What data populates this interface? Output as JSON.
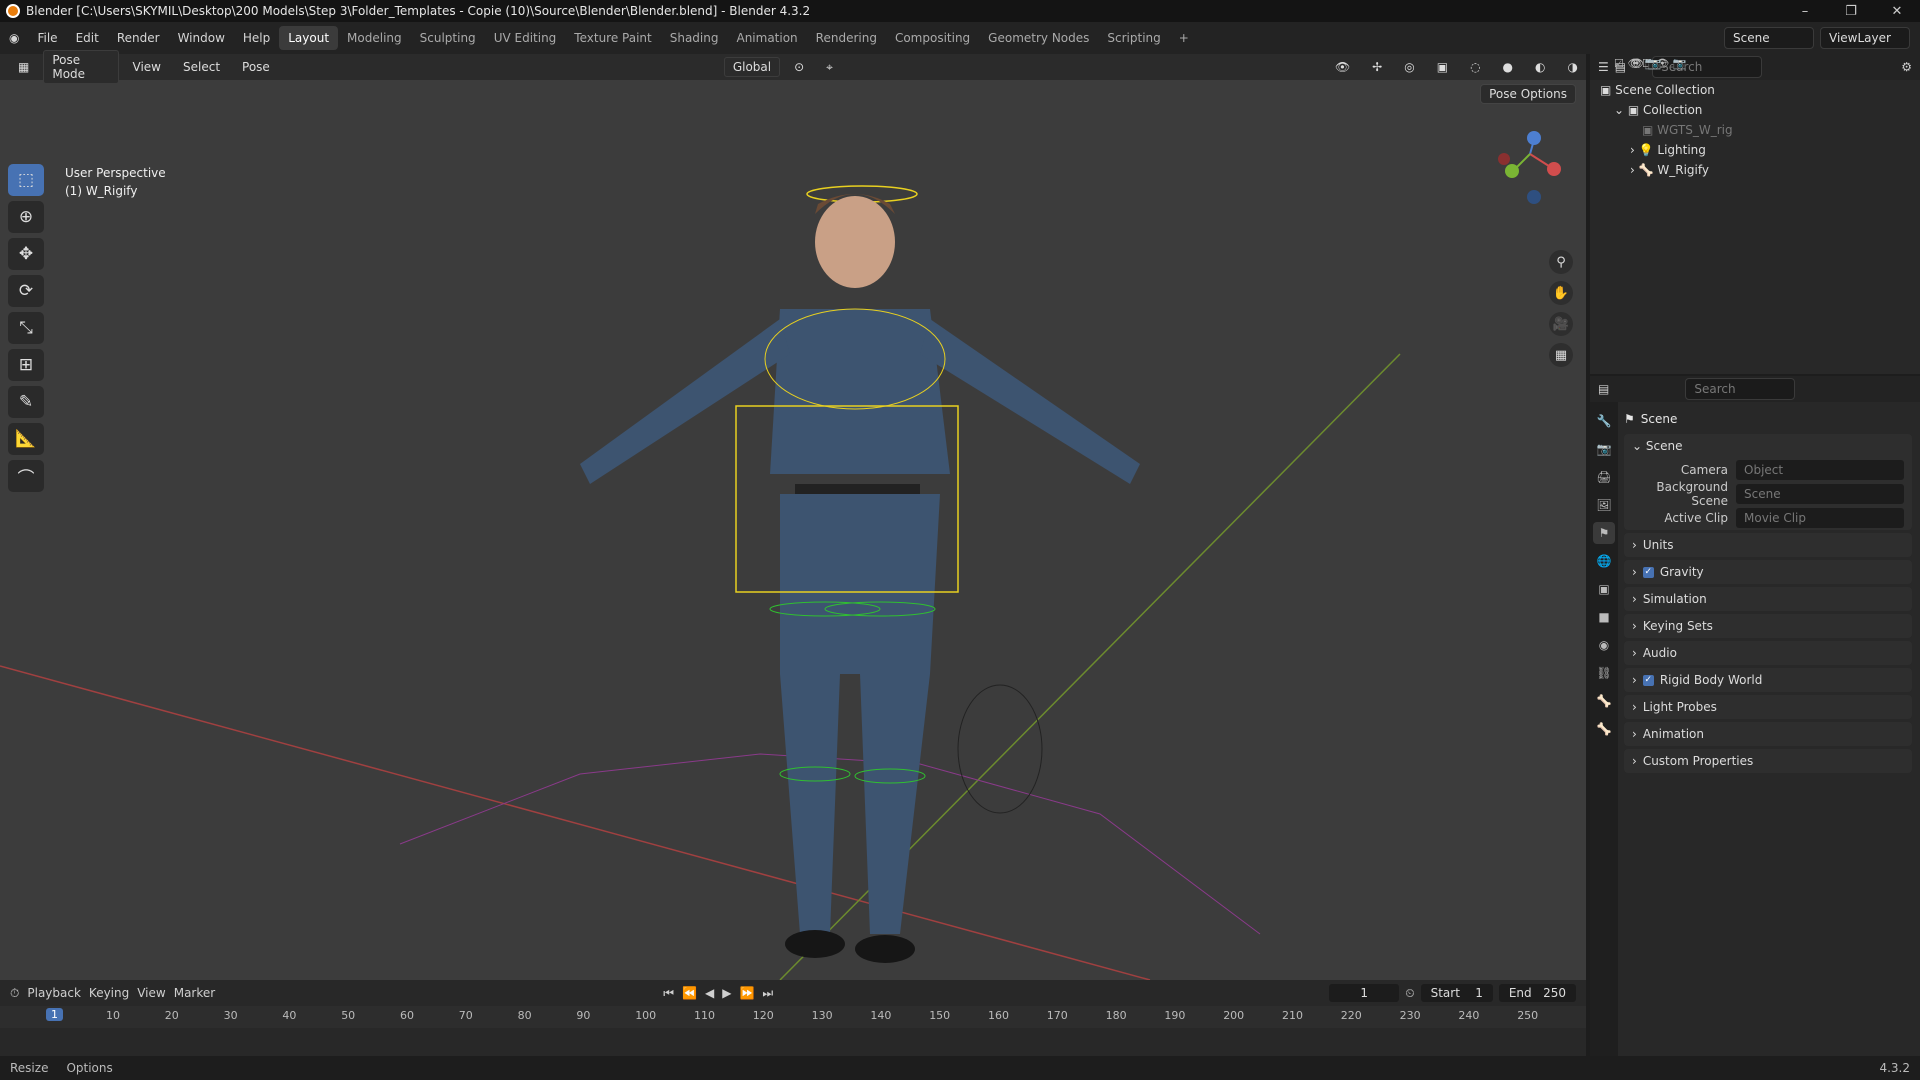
{
  "window": {
    "title": "Blender [C:\\Users\\SKYMIL\\Desktop\\200 Models\\Step 3\\Folder_Templates - Copie (10)\\Source\\Blender\\Blender.blend] - Blender 4.3.2"
  },
  "menu": [
    "File",
    "Edit",
    "Render",
    "Window",
    "Help"
  ],
  "workspaces": [
    "Layout",
    "Modeling",
    "Sculpting",
    "UV Editing",
    "Texture Paint",
    "Shading",
    "Animation",
    "Rendering",
    "Compositing",
    "Geometry Nodes",
    "Scripting"
  ],
  "active_workspace": "Layout",
  "scene_field": "Scene",
  "viewlayer_field": "ViewLayer",
  "viewport": {
    "mode": "Pose Mode",
    "menus": [
      "View",
      "Select",
      "Pose"
    ],
    "orientation": "Global",
    "info_line1": "User Perspective",
    "info_line2": "(1) W_Rigify",
    "pose_options": "Pose Options"
  },
  "outliner": {
    "search_placeholder": "Search",
    "root": "Scene Collection",
    "collection": "Collection",
    "items": [
      "WGTS_W_rig",
      "Lighting",
      "W_Rigify"
    ]
  },
  "properties": {
    "search_placeholder": "Search",
    "title": "Scene",
    "panel_title": "Scene",
    "camera_label": "Camera",
    "camera_value": "Object",
    "bg_label": "Background Scene",
    "bg_value": "Scene",
    "clip_label": "Active Clip",
    "clip_value": "Movie Clip",
    "sections": [
      {
        "label": "Units",
        "checkbox": false
      },
      {
        "label": "Gravity",
        "checkbox": true
      },
      {
        "label": "Simulation",
        "checkbox": false
      },
      {
        "label": "Keying Sets",
        "checkbox": false
      },
      {
        "label": "Audio",
        "checkbox": false
      },
      {
        "label": "Rigid Body World",
        "checkbox": true
      },
      {
        "label": "Light Probes",
        "checkbox": false
      },
      {
        "label": "Animation",
        "checkbox": false
      },
      {
        "label": "Custom Properties",
        "checkbox": false
      }
    ]
  },
  "timeline": {
    "menus": [
      "Playback",
      "Keying",
      "View",
      "Marker"
    ],
    "current_frame": "1",
    "start_label": "Start",
    "start": "1",
    "end_label": "End",
    "end": "250",
    "ticks": [
      "10",
      "20",
      "30",
      "40",
      "50",
      "60",
      "70",
      "80",
      "90",
      "100",
      "110",
      "120",
      "130",
      "140",
      "150",
      "160",
      "170",
      "180",
      "190",
      "200",
      "210",
      "220",
      "230",
      "240",
      "250"
    ]
  },
  "status": {
    "left1": "Resize",
    "left2": "Options",
    "version": "4.3.2"
  }
}
